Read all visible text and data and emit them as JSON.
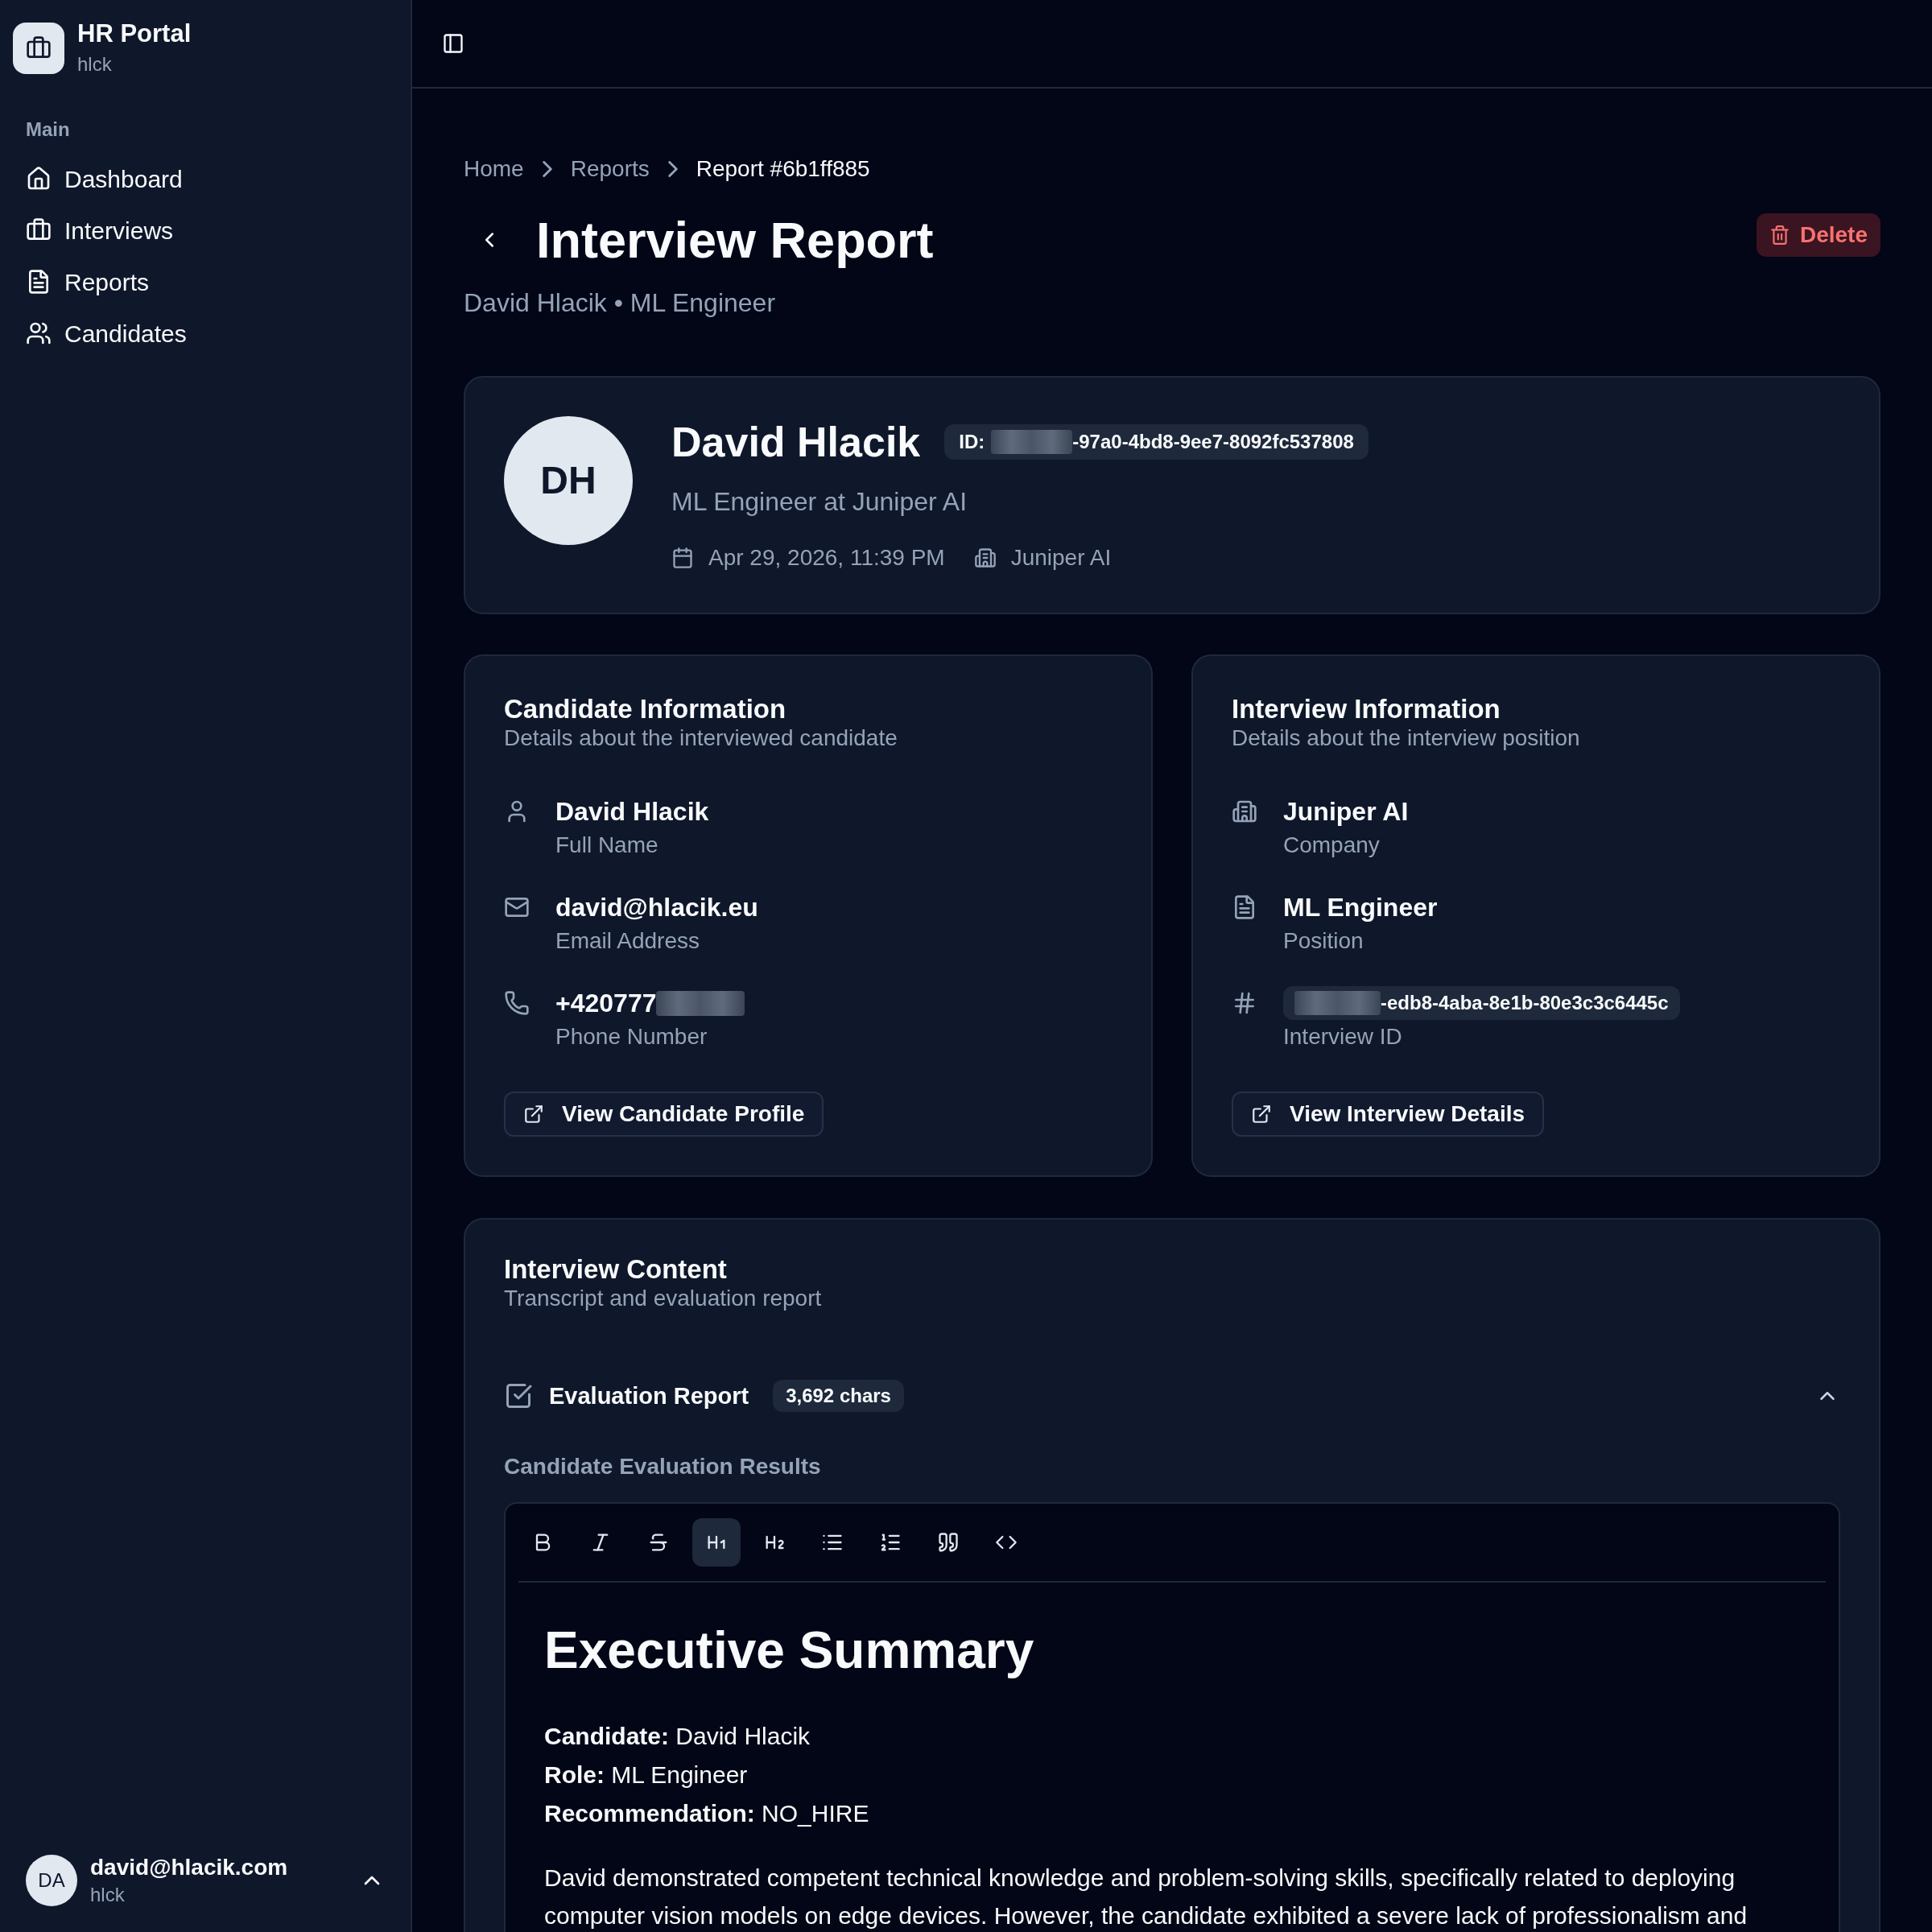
{
  "sidebar": {
    "app_name": "HR Portal",
    "workspace": "hlck",
    "group_label": "Main",
    "items": [
      {
        "label": "Dashboard"
      },
      {
        "label": "Interviews"
      },
      {
        "label": "Reports"
      },
      {
        "label": "Candidates"
      }
    ],
    "user": {
      "initials": "DA",
      "email": "david@hlacik.com",
      "workspace": "hlck"
    }
  },
  "breadcrumb": [
    {
      "label": "Home",
      "current": false
    },
    {
      "label": "Reports",
      "current": false
    },
    {
      "label": "Report #6b1ff885",
      "current": true
    }
  ],
  "page": {
    "title": "Interview Report",
    "subtitle": "David Hlacik • ML Engineer",
    "delete_label": "Delete"
  },
  "profile": {
    "initials": "DH",
    "name": "David Hlacik",
    "id_label": "ID:",
    "id_redacted": true,
    "id_value": "-97a0-4bd8-9ee7-8092fc537808",
    "headline": "ML Engineer at Juniper AI",
    "date": "Apr 29, 2026, 11:39 PM",
    "company": "Juniper AI"
  },
  "candidate_info": {
    "title": "Candidate Information",
    "description": "Details about the interviewed candidate",
    "fields": [
      {
        "kind": "text",
        "value": "David Hlacik",
        "redacted": false,
        "label": "Full Name"
      },
      {
        "kind": "text",
        "value": "david@hlacik.eu",
        "redacted": false,
        "label": "Email Address"
      },
      {
        "kind": "text",
        "value": "+420777",
        "redacted": true,
        "label": "Phone Number"
      }
    ],
    "button": "View Candidate Profile"
  },
  "interview_info": {
    "title": "Interview Information",
    "description": "Details about the interview position",
    "fields": [
      {
        "kind": "text",
        "value": "Juniper AI",
        "redacted": false,
        "label": "Company"
      },
      {
        "kind": "text",
        "value": "ML Engineer",
        "redacted": false,
        "label": "Position"
      },
      {
        "kind": "badge",
        "value": "-edb8-4aba-8e1b-80e3c3c6445c",
        "redacted": true,
        "label": "Interview ID"
      }
    ],
    "button": "View Interview Details"
  },
  "content": {
    "title": "Interview Content",
    "description": "Transcript and evaluation report",
    "section": {
      "title": "Evaluation Report",
      "badge": "3,692 chars",
      "expanded": true,
      "heading": "Candidate Evaluation Results",
      "toolbar": [
        {
          "active": false
        },
        {
          "active": false
        },
        {
          "active": false
        },
        {
          "active": true
        },
        {
          "active": false
        },
        {
          "active": false
        },
        {
          "active": false
        },
        {
          "active": false
        },
        {
          "active": false
        }
      ],
      "document": {
        "heading": "Executive Summary",
        "lines": [
          "**Candidate:** David Hlacik",
          "**Role:** ML Engineer",
          "**Recommendation:** NO_HIRE"
        ],
        "paragraph": "David demonstrated competent technical knowledge and problem-solving skills, specifically related to deploying computer vision models on edge devices. However, the candidate exhibited a severe lack of professionalism and"
      }
    }
  }
}
